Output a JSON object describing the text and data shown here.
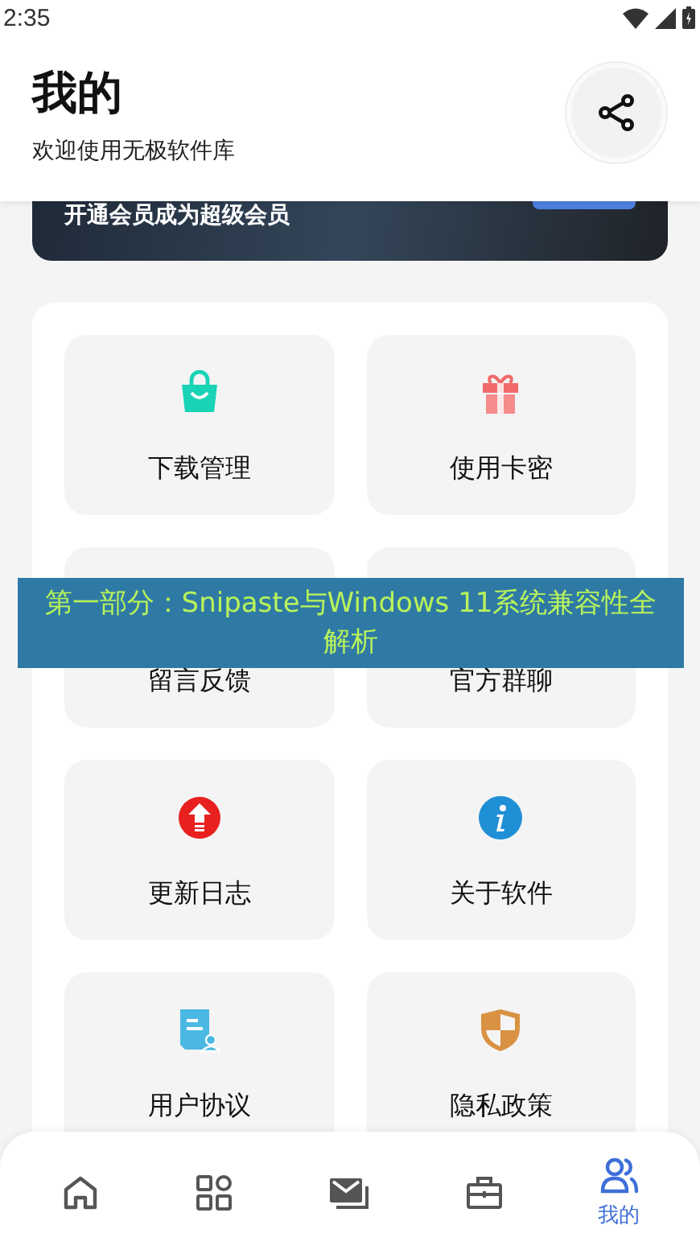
{
  "status_bar": {
    "time": "2:35"
  },
  "header": {
    "title": "我的",
    "subtitle": "欢迎使用无极软件库"
  },
  "vip_card": {
    "text": "开通会员成为超级会员"
  },
  "menu": [
    {
      "label": "下载管理",
      "kind": "bag"
    },
    {
      "label": "使用卡密",
      "kind": "gift"
    },
    {
      "label": "留言反馈",
      "kind": "hidden"
    },
    {
      "label": "官方群聊",
      "kind": "hidden"
    },
    {
      "label": "更新日志",
      "kind": "update"
    },
    {
      "label": "关于软件",
      "kind": "info"
    },
    {
      "label": "用户协议",
      "kind": "doc"
    },
    {
      "label": "隐私政策",
      "kind": "shield"
    }
  ],
  "caption_banner": {
    "text": "第一部分：Snipaste与Windows 11系统兼容性全解析"
  },
  "bottom_nav": [
    {
      "kind": "home",
      "selected": false
    },
    {
      "kind": "apps",
      "selected": false
    },
    {
      "kind": "mail",
      "selected": false
    },
    {
      "kind": "toolbox",
      "selected": false
    },
    {
      "kind": "profile",
      "selected": true,
      "label": "我的"
    }
  ]
}
